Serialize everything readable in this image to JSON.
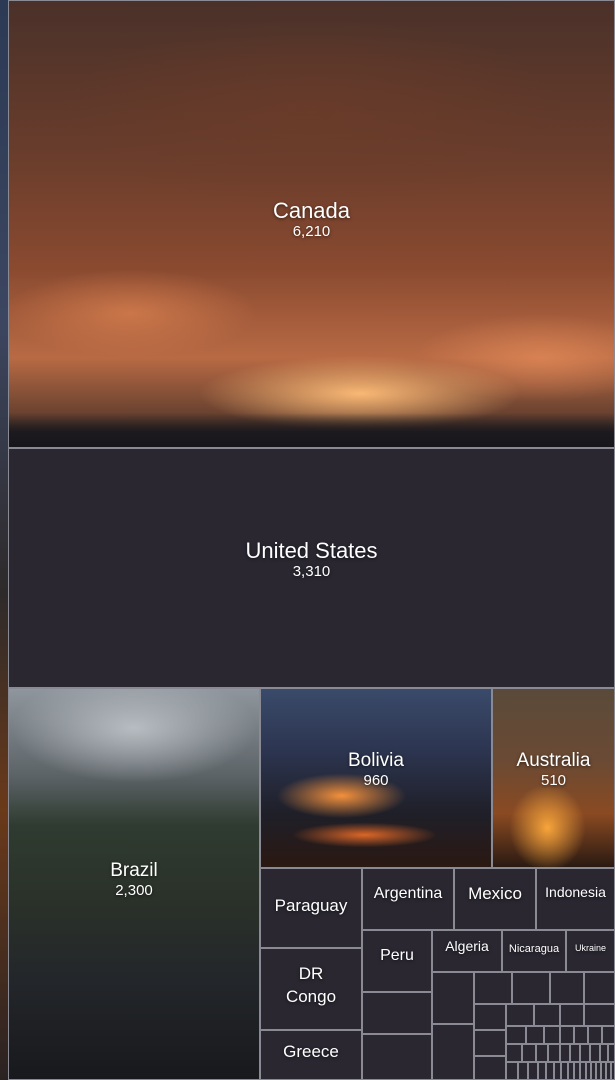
{
  "chart_data": {
    "type": "treemap",
    "title": "",
    "items": [
      {
        "name": "Canada",
        "value": 6210,
        "value_label": "6,210"
      },
      {
        "name": "United States",
        "value": 3310,
        "value_label": "3,310"
      },
      {
        "name": "Brazil",
        "value": 2300,
        "value_label": "2,300"
      },
      {
        "name": "Bolivia",
        "value": 960,
        "value_label": "960"
      },
      {
        "name": "Australia",
        "value": 510,
        "value_label": "510"
      },
      {
        "name": "Paraguay",
        "value_label": ""
      },
      {
        "name": "Argentina",
        "value_label": ""
      },
      {
        "name": "Mexico",
        "value_label": ""
      },
      {
        "name": "Indonesia",
        "value_label": ""
      },
      {
        "name": "Peru",
        "value_label": ""
      },
      {
        "name": "Algeria",
        "value_label": ""
      },
      {
        "name": "Nicaragua",
        "value_label": ""
      },
      {
        "name": "Ukraine",
        "value_label": ""
      },
      {
        "name": "DR Congo",
        "value_label": ""
      },
      {
        "name": "Greece",
        "value_label": ""
      }
    ],
    "colors": {
      "tile": "#2a2731",
      "border": "#8a8a95",
      "text": "#ffffff"
    }
  }
}
